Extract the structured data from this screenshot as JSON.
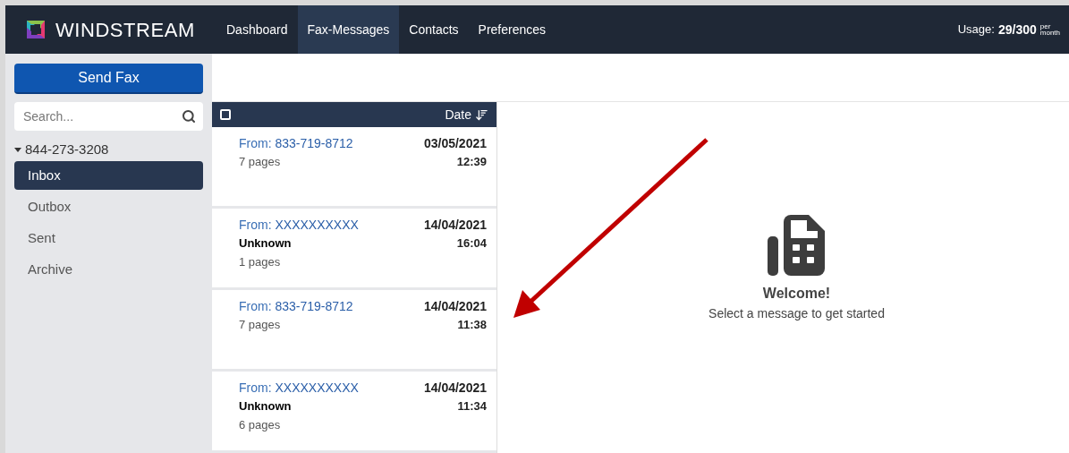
{
  "header": {
    "logo": "WINDSTREAM",
    "nav": [
      {
        "label": "Dashboard",
        "selected": false
      },
      {
        "label": "Fax-Messages",
        "selected": true
      },
      {
        "label": "Contacts",
        "selected": false
      },
      {
        "label": "Preferences",
        "selected": false
      }
    ],
    "usage": {
      "label": "Usage:",
      "value": "29/300",
      "unit_top": "per",
      "unit_bottom": "month"
    }
  },
  "sidebar": {
    "send_button": "Send Fax",
    "search": {
      "placeholder": "Search..."
    },
    "account": {
      "number": "844-273-3208",
      "expanded": true
    },
    "folders": [
      {
        "label": "Inbox",
        "selected": true
      },
      {
        "label": "Outbox",
        "selected": false
      },
      {
        "label": "Sent",
        "selected": false
      },
      {
        "label": "Archive",
        "selected": false
      }
    ]
  },
  "list": {
    "select_all": {
      "checked": false
    },
    "sort_label": "Date",
    "messages": [
      {
        "from_label": "From:",
        "from": "833-719-8712",
        "pages": "7 pages",
        "date": "03/05/2021",
        "time": "12:39"
      },
      {
        "from_label": "From:",
        "from": "XXXXXXXXXX",
        "caller": "Unknown",
        "pages": "1 pages",
        "date": "14/04/2021",
        "time": "16:04"
      },
      {
        "from_label": "From:",
        "from": "833-719-8712",
        "pages": "7 pages",
        "date": "14/04/2021",
        "time": "11:38"
      },
      {
        "from_label": "From:",
        "from": "XXXXXXXXXX",
        "caller": "Unknown",
        "pages": "6 pages",
        "date": "14/04/2021",
        "time": "11:34"
      }
    ]
  },
  "welcome": {
    "title": "Welcome!",
    "subtitle": "Select a message to get started"
  }
}
